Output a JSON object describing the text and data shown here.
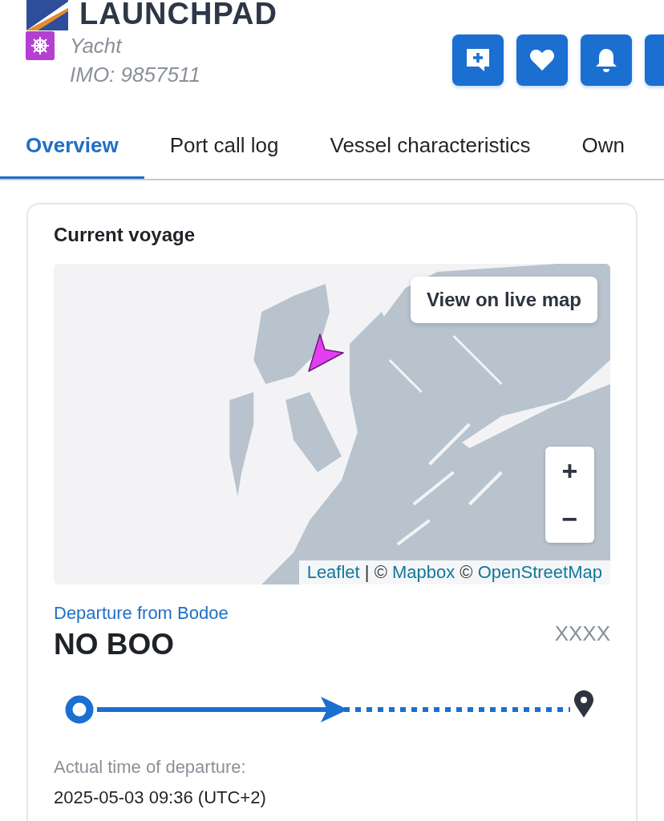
{
  "vessel": {
    "name": "LAUNCHPAD",
    "type": "Yacht",
    "imo": "IMO: 9857511"
  },
  "actions": [
    {
      "kind": "comment"
    },
    {
      "kind": "favorite"
    },
    {
      "kind": "alert"
    },
    {
      "kind": "partial"
    }
  ],
  "tabs": [
    {
      "label": "Overview",
      "selected": true
    },
    {
      "label": "Port call log",
      "selected": false
    },
    {
      "label": "Vessel characteristics",
      "selected": false
    },
    {
      "label": "Own",
      "selected": false
    }
  ],
  "voyage": {
    "title": "Current voyage",
    "map": {
      "kind": "picture",
      "live_map_button": "View on live map",
      "zoom_in": "+",
      "zoom_out": "−",
      "attribution": [
        {
          "kind": "link",
          "text": "Leaflet"
        },
        {
          "kind": "text",
          "text": " | © "
        },
        {
          "kind": "link",
          "text": "Mapbox"
        },
        {
          "kind": "text",
          "text": " © "
        },
        {
          "kind": "link",
          "text": "OpenStreetMap"
        }
      ]
    },
    "departure_label": "Departure from Bodoe",
    "port_code": "NO BOO",
    "destination": "XXXX",
    "level": 0.53,
    "time_label": "Actual time of departure:",
    "time": "2025-05-03 09:36 (UTC+2)"
  }
}
